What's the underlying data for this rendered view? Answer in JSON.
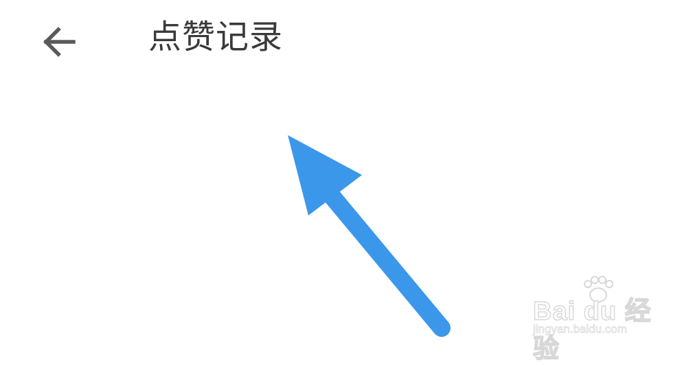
{
  "header": {
    "back_icon": "arrow-left-icon",
    "title": "点赞记录"
  },
  "annotation": {
    "arrow_icon": "pointer-arrow-icon",
    "color": "#3b97ea"
  },
  "watermark": {
    "brand": "Bai du 经验",
    "url": "jingyan.baidu.com"
  },
  "colors": {
    "background": "#ffffff",
    "title_text": "#3a3a3a",
    "icon": "#5a5a5a"
  }
}
